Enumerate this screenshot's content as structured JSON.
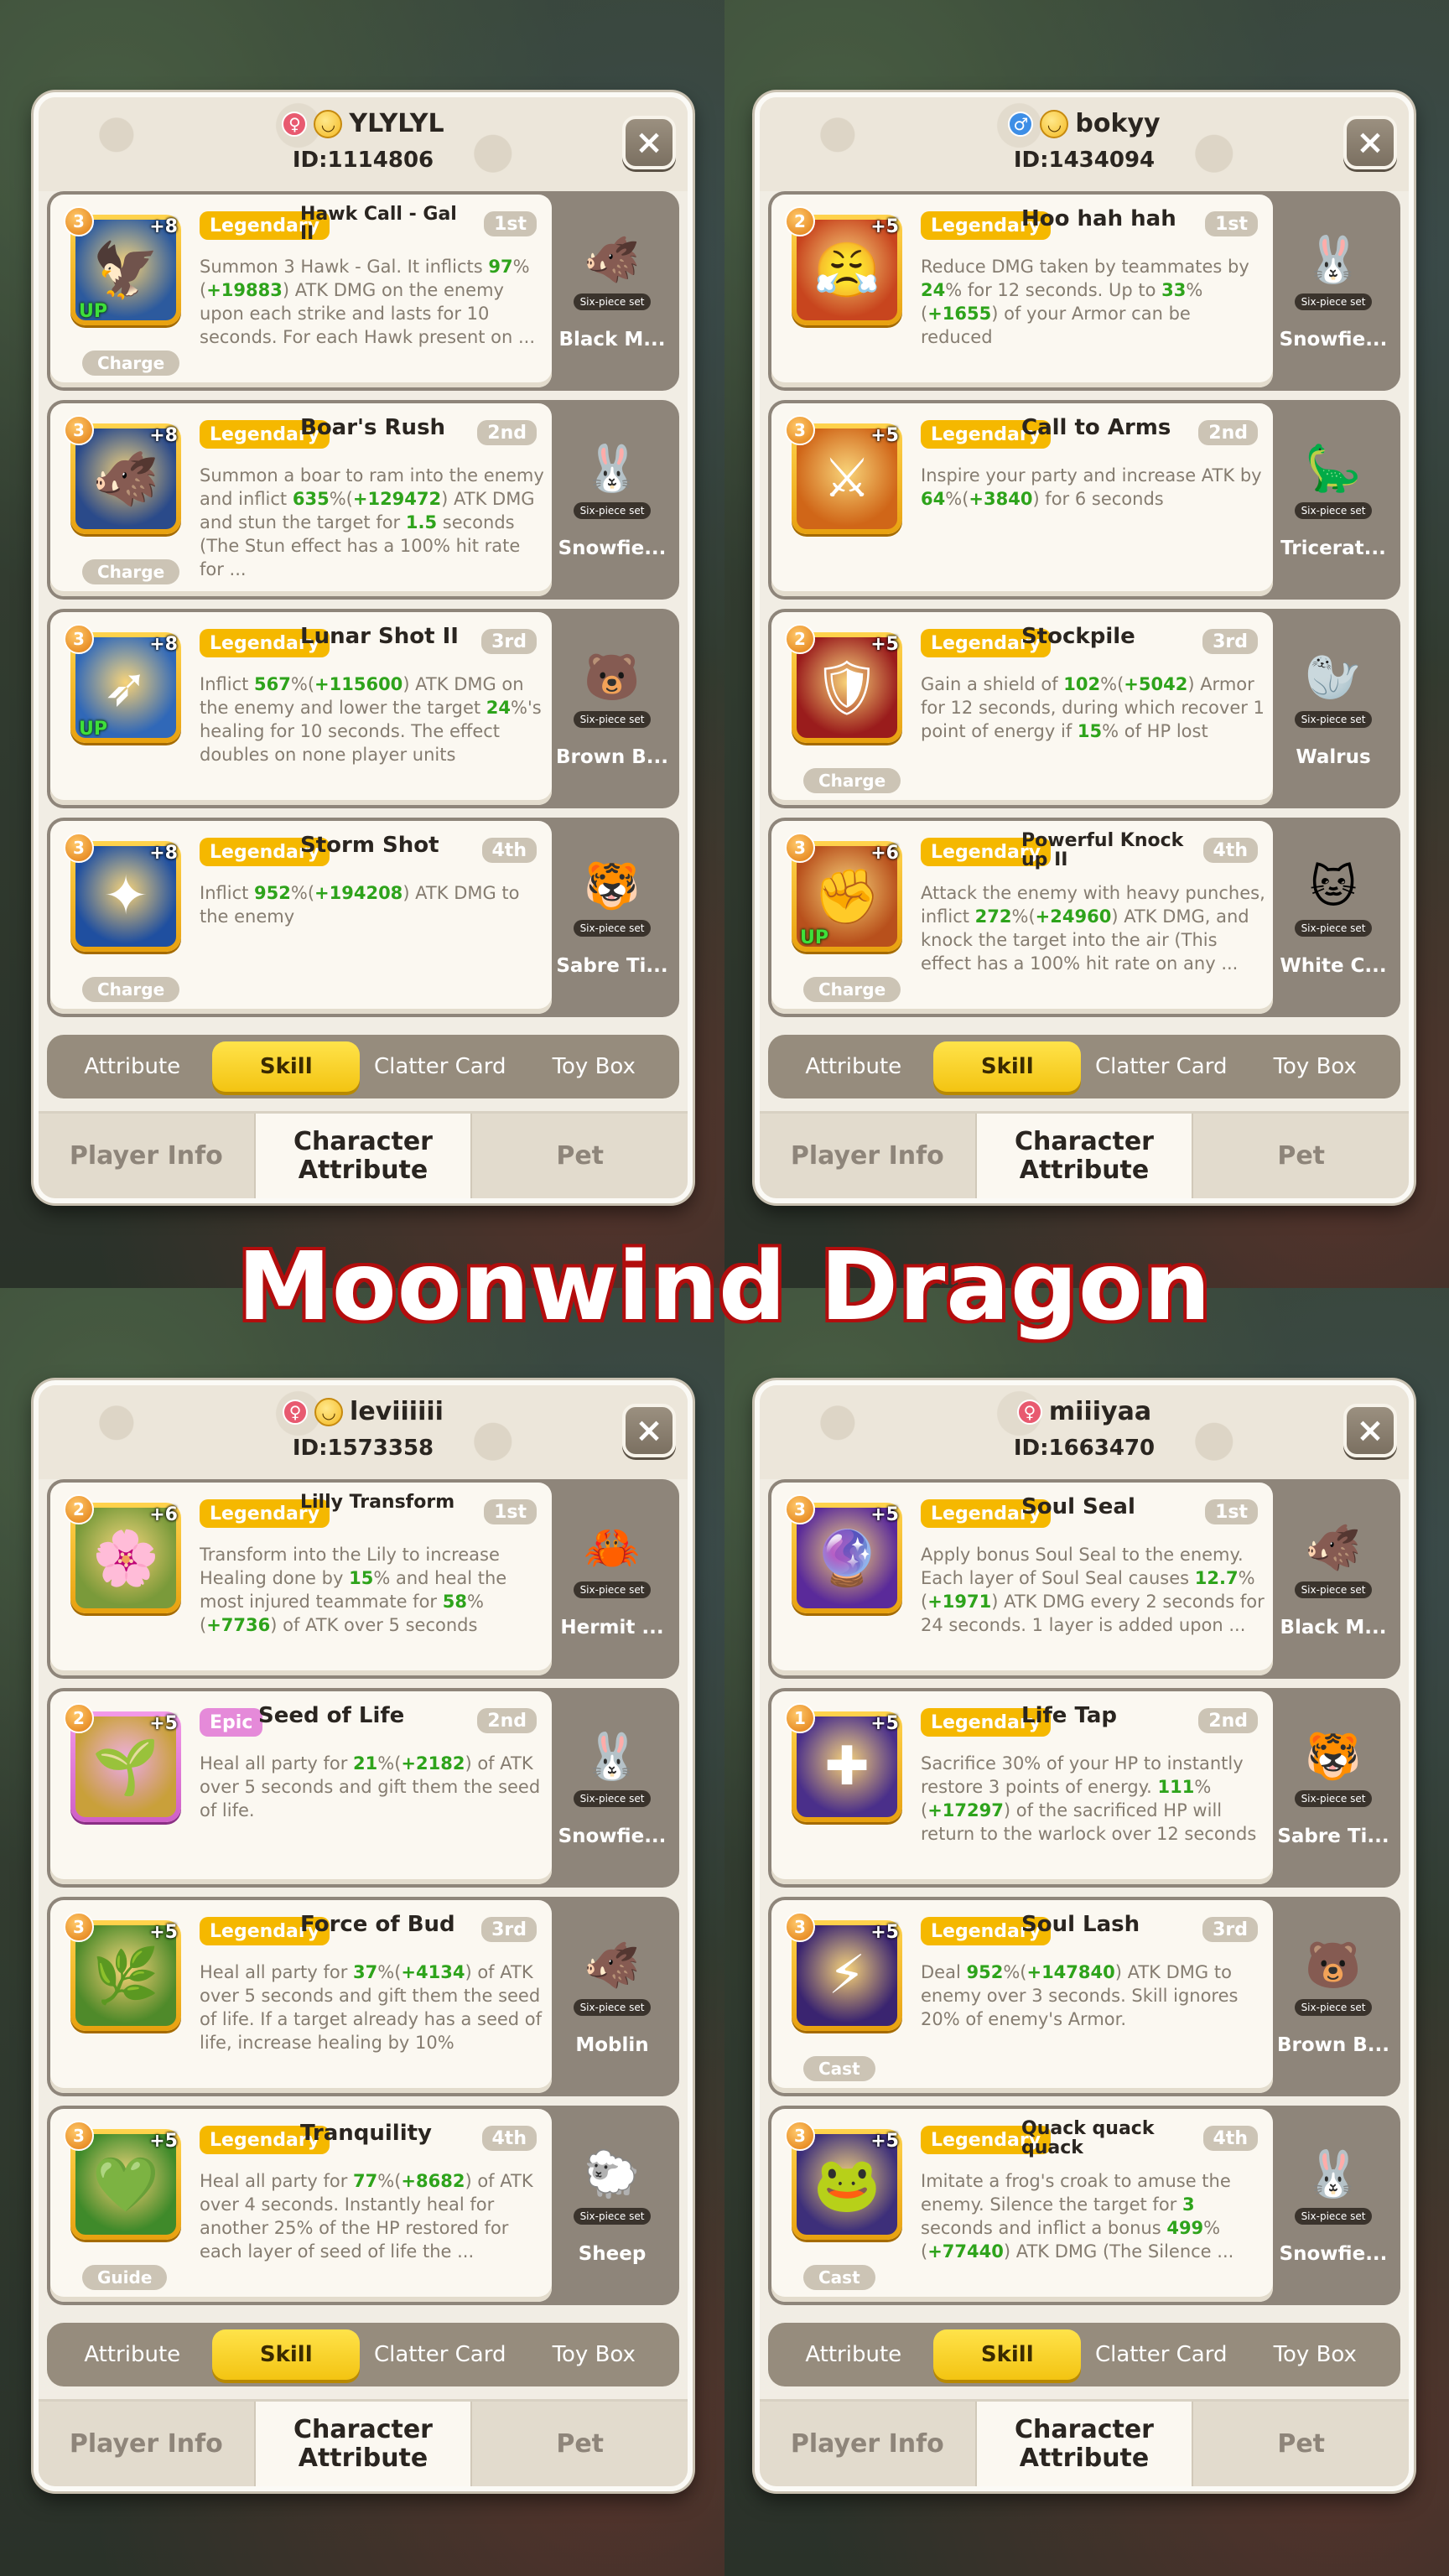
{
  "banner": "Moonwind Dragon",
  "colors": {
    "legendary": "#f5b800",
    "epic": "#e58ad9",
    "highlight_green": "#2ea31b",
    "active_tab": "#f3c412"
  },
  "panels": [
    {
      "player": {
        "name": "YLYLYL",
        "id": "ID:1114806",
        "gender": "female"
      },
      "skills": [
        {
          "level": "3",
          "plus": "+8",
          "up": "UP",
          "type": "Charge",
          "rarity": "Legendary",
          "name": "Hawk Call - Gal II",
          "order": "1st",
          "icon": "hawk-icon",
          "desc_html": "Summon 3 Hawk - Gal. It inflicts <b>97</b>%(<b>+19883</b>) ATK DMG on the enemy upon each strike and lasts for 10 seconds. For each Hawk present on ...",
          "pet": "Black M...",
          "pet_icon": "boar-pet-icon",
          "set": "Six-piece set"
        },
        {
          "level": "3",
          "plus": "+8",
          "up": "",
          "type": "Charge",
          "rarity": "Legendary",
          "name": "Boar's Rush",
          "order": "2nd",
          "icon": "boar-icon",
          "desc_html": "Summon a boar to ram into the enemy and inflict <b>635</b>%(<b>+129472</b>) ATK DMG and stun the target for <b>1.5</b> seconds (The Stun effect has a 100% hit rate for ...",
          "pet": "Snowfie...",
          "pet_icon": "snowfield-pet-icon",
          "set": "Six-piece set"
        },
        {
          "level": "3",
          "plus": "+8",
          "up": "UP",
          "type": "",
          "rarity": "Legendary",
          "name": "Lunar Shot II",
          "order": "3rd",
          "icon": "lunar-shot-icon",
          "desc_html": "Inflict <b>567</b>%(<b>+115600</b>) ATK DMG on the enemy and lower the target <b>24</b>%'s healing for 10 seconds. The effect doubles on none player units",
          "pet": "Brown B...",
          "pet_icon": "bee-bear-pet-icon",
          "set": "Six-piece set"
        },
        {
          "level": "3",
          "plus": "+8",
          "up": "",
          "type": "Charge",
          "rarity": "Legendary",
          "name": "Storm Shot",
          "order": "4th",
          "icon": "storm-shot-icon",
          "desc_html": "Inflict <b>952</b>%(<b>+194208</b>) ATK DMG to the enemy",
          "pet": "Sabre Ti...",
          "pet_icon": "tiger-pet-icon",
          "set": "Six-piece set"
        }
      ]
    },
    {
      "player": {
        "name": "bokyy",
        "id": "ID:1434094",
        "gender": "male"
      },
      "skills": [
        {
          "level": "2",
          "plus": "+5",
          "up": "",
          "type": "",
          "rarity": "Legendary",
          "name": "Hoo hah hah",
          "order": "1st",
          "icon": "shout-icon",
          "desc_html": "Reduce DMG taken by teammates by <b>24</b>% for 12 seconds. Up to <b>33</b>%(<b>+1655</b>) of your Armor can be reduced",
          "pet": "Snowfie...",
          "pet_icon": "snowfield-pet-icon",
          "set": "Six-piece set"
        },
        {
          "level": "3",
          "plus": "+5",
          "up": "",
          "type": "",
          "rarity": "Legendary",
          "name": "Call to Arms",
          "order": "2nd",
          "icon": "call-arms-icon",
          "desc_html": "Inspire your party and increase ATK by <b>64</b>%(<b>+3840</b>) for 6 seconds",
          "pet": "Tricerat...",
          "pet_icon": "triceratops-pet-icon",
          "set": "Six-piece set"
        },
        {
          "level": "2",
          "plus": "+5",
          "up": "",
          "type": "Charge",
          "rarity": "Legendary",
          "name": "Stockpile",
          "order": "3rd",
          "icon": "stockpile-icon",
          "desc_html": "Gain a shield of <b>102</b>%(<b>+5042</b>) Armor for 12 seconds, during which recover 1 point of energy if <b>15</b>% of HP lost",
          "pet": "Walrus",
          "pet_icon": "walrus-pet-icon",
          "set": "Six-piece set"
        },
        {
          "level": "3",
          "plus": "+6",
          "up": "UP",
          "type": "Charge",
          "rarity": "Legendary",
          "name": "Powerful Knock up II",
          "order": "4th",
          "icon": "knockup-icon",
          "desc_html": "Attack the enemy with heavy punches, inflict <b>272</b>%(<b>+24960</b>) ATK DMG, and knock the target into the air (This effect has a 100% hit rate on any ...",
          "pet": "White C...",
          "pet_icon": "white-cat-pet-icon",
          "set": "Six-piece set"
        }
      ]
    },
    {
      "player": {
        "name": "leviiiiii",
        "id": "ID:1573358",
        "gender": "female"
      },
      "skills": [
        {
          "level": "2",
          "plus": "+6",
          "up": "",
          "type": "",
          "rarity": "Legendary",
          "name": "Lilly Transform",
          "order": "1st",
          "icon": "lily-icon",
          "desc_html": "Transform into the Lily to increase Healing done by <b>15</b>% and heal the most injured teammate for <b>58</b>%(<b>+7736</b>) of ATK over 5 seconds",
          "pet": "Hermit ...",
          "pet_icon": "hermit-pet-icon",
          "set": "Six-piece set"
        },
        {
          "level": "2",
          "plus": "+5",
          "up": "",
          "type": "",
          "rarity": "Epic",
          "name": "Seed of Life",
          "order": "2nd",
          "icon": "seed-icon",
          "desc_html": "Heal all party for <b>21</b>%(<b>+2182</b>) of ATK over 5 seconds and gift them the seed of life.",
          "pet": "Snowfie...",
          "pet_icon": "snowfield-pet-icon",
          "set": "Six-piece set"
        },
        {
          "level": "3",
          "plus": "+5",
          "up": "",
          "type": "",
          "rarity": "Legendary",
          "name": "Force of Bud",
          "order": "3rd",
          "icon": "bud-icon",
          "desc_html": "Heal all party for <b>37</b>%(<b>+4134</b>) of ATK over 5 seconds and gift them the seed of life. If a target already has a seed of life, increase healing by 10%",
          "pet": "Moblin",
          "pet_icon": "moblin-pet-icon",
          "set": "Six-piece set"
        },
        {
          "level": "3",
          "plus": "+5",
          "up": "",
          "type": "Guide",
          "rarity": "Legendary",
          "name": "Tranquility",
          "order": "4th",
          "icon": "tranquility-icon",
          "desc_html": "Heal all party for <b>77</b>%(<b>+8682</b>) of ATK over 4 seconds. Instantly heal for another 25% of the HP restored for each layer of seed of life the ...",
          "pet": "Sheep",
          "pet_icon": "sheep-pet-icon",
          "set": "Six-piece set"
        }
      ]
    },
    {
      "player": {
        "name": "miiiyaa",
        "id": "ID:1663470",
        "gender": "female"
      },
      "skills": [
        {
          "level": "3",
          "plus": "+5",
          "up": "",
          "type": "",
          "rarity": "Legendary",
          "name": "Soul Seal",
          "order": "1st",
          "icon": "soul-seal-icon",
          "desc_html": "Apply bonus Soul Seal to the enemy. Each layer of Soul Seal causes <b>12.7</b>%(<b>+1971</b>) ATK DMG every 2 seconds for 24 seconds. 1 layer is added upon ...",
          "pet": "Black M...",
          "pet_icon": "boar-pet-icon",
          "set": "Six-piece set"
        },
        {
          "level": "1",
          "plus": "+5",
          "up": "",
          "type": "",
          "rarity": "Legendary",
          "name": "Life Tap",
          "order": "2nd",
          "icon": "life-tap-icon",
          "desc_html": "Sacrifice 30% of your HP to instantly restore 3 points of energy. <b>111</b>%(<b>+17297</b>) of the sacrificed HP will return to the warlock over 12 seconds",
          "pet": "Sabre Ti...",
          "pet_icon": "tiger-pet-icon",
          "set": "Six-piece set"
        },
        {
          "level": "3",
          "plus": "+5",
          "up": "",
          "type": "Cast",
          "rarity": "Legendary",
          "name": "Soul Lash",
          "order": "3rd",
          "icon": "soul-lash-icon",
          "desc_html": "Deal <b>952</b>%(<b>+147840</b>) ATK DMG to enemy over 3 seconds. Skill ignores 20% of enemy's Armor.",
          "pet": "Brown B...",
          "pet_icon": "bee-bear-pet-icon",
          "set": "Six-piece set"
        },
        {
          "level": "3",
          "plus": "+5",
          "up": "",
          "type": "Cast",
          "rarity": "Legendary",
          "name": "Quack quack quack",
          "order": "4th",
          "icon": "quack-icon",
          "desc_html": "Imitate a frog's croak to amuse the enemy. Silence the target for <b>3</b> seconds and inflict a bonus <b>499</b>%(<b>+77440</b>) ATK DMG (The Silence ...",
          "pet": "Snowfie...",
          "pet_icon": "snowfield-pet-icon",
          "set": "Six-piece set"
        }
      ]
    }
  ],
  "sub_tabs": [
    "Attribute",
    "Skill",
    "Clatter Card",
    "Toy Box"
  ],
  "main_tabs": [
    "Player Info",
    "Character Attribute",
    "Pet"
  ],
  "close_glyph": "×"
}
